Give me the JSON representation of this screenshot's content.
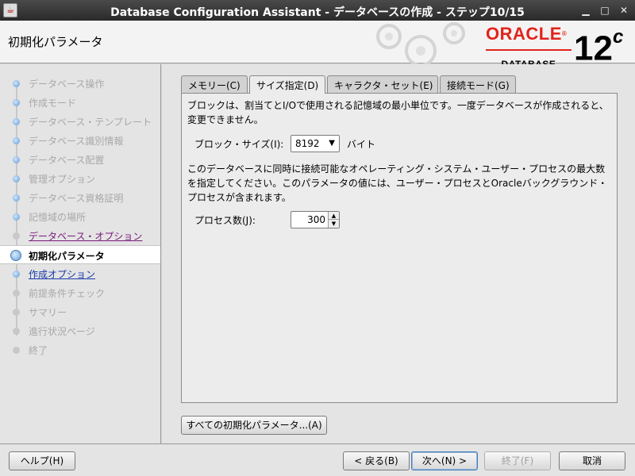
{
  "window": {
    "title": "Database Configuration Assistant - データベースの作成 - ステップ10/15",
    "app_icon": "java-cup-icon",
    "controls": [
      "minimize-icon",
      "maximize-icon",
      "close-icon"
    ]
  },
  "header": {
    "page_title": "初期化パラメータ",
    "brand": "ORACLE",
    "brand_mark": "®",
    "product": "DATABASE",
    "version": "12",
    "version_suffix": "c"
  },
  "steps": [
    {
      "label": "データベース操作",
      "state": "done"
    },
    {
      "label": "作成モード",
      "state": "done"
    },
    {
      "label": "データベース・テンプレート",
      "state": "done"
    },
    {
      "label": "データベース識別情報",
      "state": "done"
    },
    {
      "label": "データベース配置",
      "state": "done"
    },
    {
      "label": "管理オプション",
      "state": "done"
    },
    {
      "label": "データベース資格証明",
      "state": "done"
    },
    {
      "label": "記憶域の場所",
      "state": "done"
    },
    {
      "label": "データベース・オプション",
      "state": "visited"
    },
    {
      "label": "初期化パラメータ",
      "state": "current"
    },
    {
      "label": "作成オプション",
      "state": "link"
    },
    {
      "label": "前提条件チェック",
      "state": "pending"
    },
    {
      "label": "サマリー",
      "state": "pending"
    },
    {
      "label": "進行状況ページ",
      "state": "pending"
    },
    {
      "label": "終了",
      "state": "pending"
    }
  ],
  "tabs": [
    {
      "label": "メモリー(C)"
    },
    {
      "label": "サイズ指定(D)"
    },
    {
      "label": "キャラクタ・セット(E)"
    },
    {
      "label": "接続モード(G)"
    }
  ],
  "sizing": {
    "block_desc": "ブロックは、割当てとI/Oで使用される記憶域の最小単位です。一度データベースが作成されると、変更できません。",
    "block_label": "ブロック・サイズ(I):",
    "block_value": "8192",
    "block_unit": "バイト",
    "process_desc": "このデータベースに同時に接続可能なオペレーティング・システム・ユーザー・プロセスの最大数を指定してください。このパラメータの値には、ユーザー・プロセスとOracleバックグラウンド・プロセスが含まれます。",
    "process_label": "プロセス数(J):",
    "process_value": "300"
  },
  "all_params_button": "すべての初期化パラメータ...(A)",
  "footer": {
    "help": "ヘルプ(H)",
    "back": "< 戻る(B)",
    "next": "次へ(N) >",
    "finish": "終了(F)",
    "cancel": "取消"
  }
}
